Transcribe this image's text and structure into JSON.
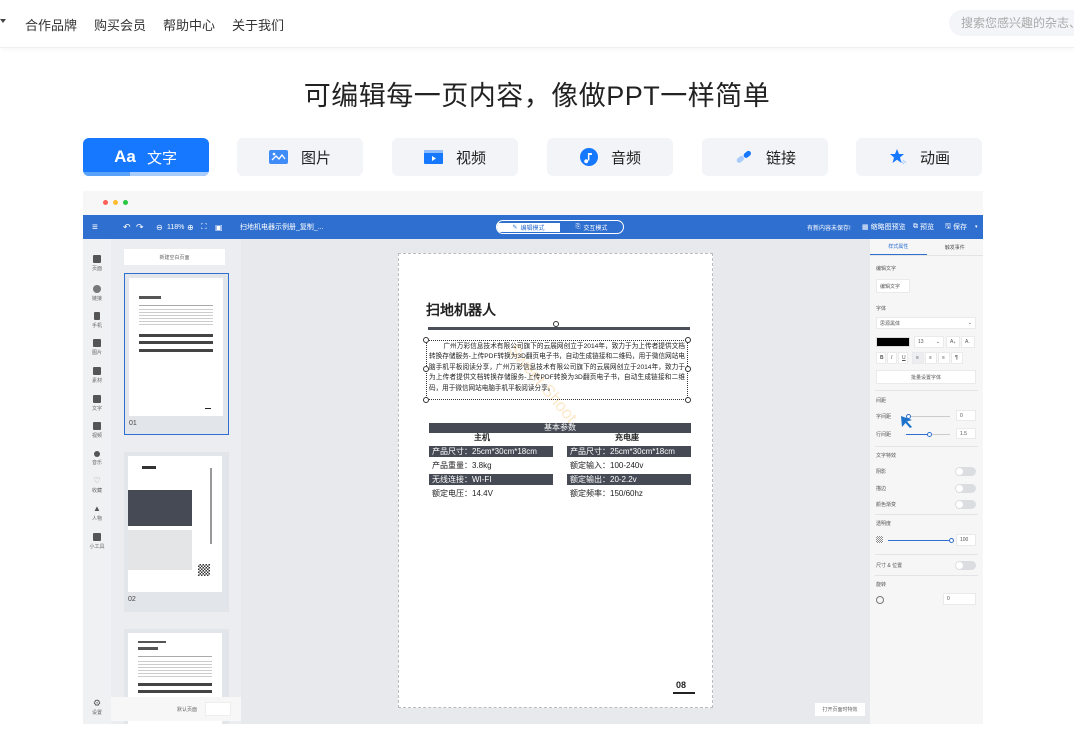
{
  "topnav": {
    "items": [
      "合作品牌",
      "购买会员",
      "帮助中心",
      "关于我们"
    ],
    "search_placeholder": "搜索您感兴趣的杂志、"
  },
  "headline": "可编辑每一页内容，像做PPT一样简单",
  "feature_tabs": [
    {
      "label": "文字",
      "icon": "text-aa-icon",
      "active": true
    },
    {
      "label": "图片",
      "icon": "image-icon",
      "active": false
    },
    {
      "label": "视频",
      "icon": "video-icon",
      "active": false
    },
    {
      "label": "音频",
      "icon": "music-note-icon",
      "active": false
    },
    {
      "label": "链接",
      "icon": "link-icon",
      "active": false
    },
    {
      "label": "动画",
      "icon": "star-icon",
      "active": false
    }
  ],
  "feature_tab_progress": 0.37,
  "editor": {
    "toolbar": {
      "zoom": "118%",
      "doc_title": "扫地机电器示例册_复制_...",
      "mode_edit": "编辑模式",
      "mode_interactive": "交互模式",
      "notice": "有新内容未保存!",
      "thumbnail_btn": "缩略图预览",
      "preview_btn": "预览",
      "save_btn": "保存"
    },
    "left_rail": [
      "页面",
      "链接",
      "手机",
      "图片",
      "素材",
      "文字",
      "视频",
      "音乐",
      "收藏",
      "人物",
      "小工具"
    ],
    "settings_label": "设置",
    "thumb_panel": {
      "new_page": "新建空白页面",
      "pages": [
        "01",
        "02"
      ],
      "footer_label": "默认页面"
    },
    "page": {
      "title": "扫地机器人",
      "body": "广州万彩信息技术有限公司旗下的云展网创立于2014年，致力于为上传者提供文档转换存储服务-上传PDF转换为3D翻页电子书，自动生成链接和二维码，用于微信网站电脑手机平板阅读分享，广州万彩信息技术有限公司旗下的云展网创立于2014年，致力于为上传者提供文档转换存储服务-上传PDF转换为3D翻页电子书，自动生成链接和二维码，用于微信网站电脑手机平板阅读分享。",
      "watermark": "Sweet Shoot",
      "params_title": "基本参数",
      "col_left": "主机",
      "col_right": "充电座",
      "rows": [
        {
          "left": "产品尺寸：25cm*30cm*18cm",
          "right": "产品尺寸：25cm*30cm*18cm",
          "dark": true
        },
        {
          "left": "产品重量：3.8kg",
          "right": "额定输入：100-240v",
          "dark": false
        },
        {
          "left": "无线连接：WI-FI",
          "right": "额定输出：20-2.2v",
          "dark": true
        },
        {
          "left": "额定电压：14.4V",
          "right": "额定频率：150/60hz",
          "dark": false
        }
      ],
      "page_number": "08"
    },
    "open_btn": "打开页面时特效",
    "props": {
      "tab_style": "样式属性",
      "tab_event": "触发事件",
      "edit_text_label": "编辑文字",
      "edit_text_btn": "编辑文字",
      "font_label": "字体",
      "font_value": "思源黑体",
      "font_size": "13",
      "color": "#000000",
      "format_buttons": [
        "B",
        "I",
        "U"
      ],
      "batch_font_btn": "批量设置字体",
      "spacing_label": "间距",
      "letter_spacing_label": "字间距",
      "letter_spacing_value": "0",
      "line_spacing_label": "行间距",
      "line_spacing_value": "1.5",
      "effects_label": "文字特效",
      "shadow_label": "阴影",
      "stroke_label": "描边",
      "gradient_label": "颜色渐变",
      "opacity_label": "透明度",
      "opacity_value": "100",
      "size_pos_label": "尺寸 & 位置",
      "rotate_label": "旋转",
      "rotate_value": "0"
    }
  }
}
